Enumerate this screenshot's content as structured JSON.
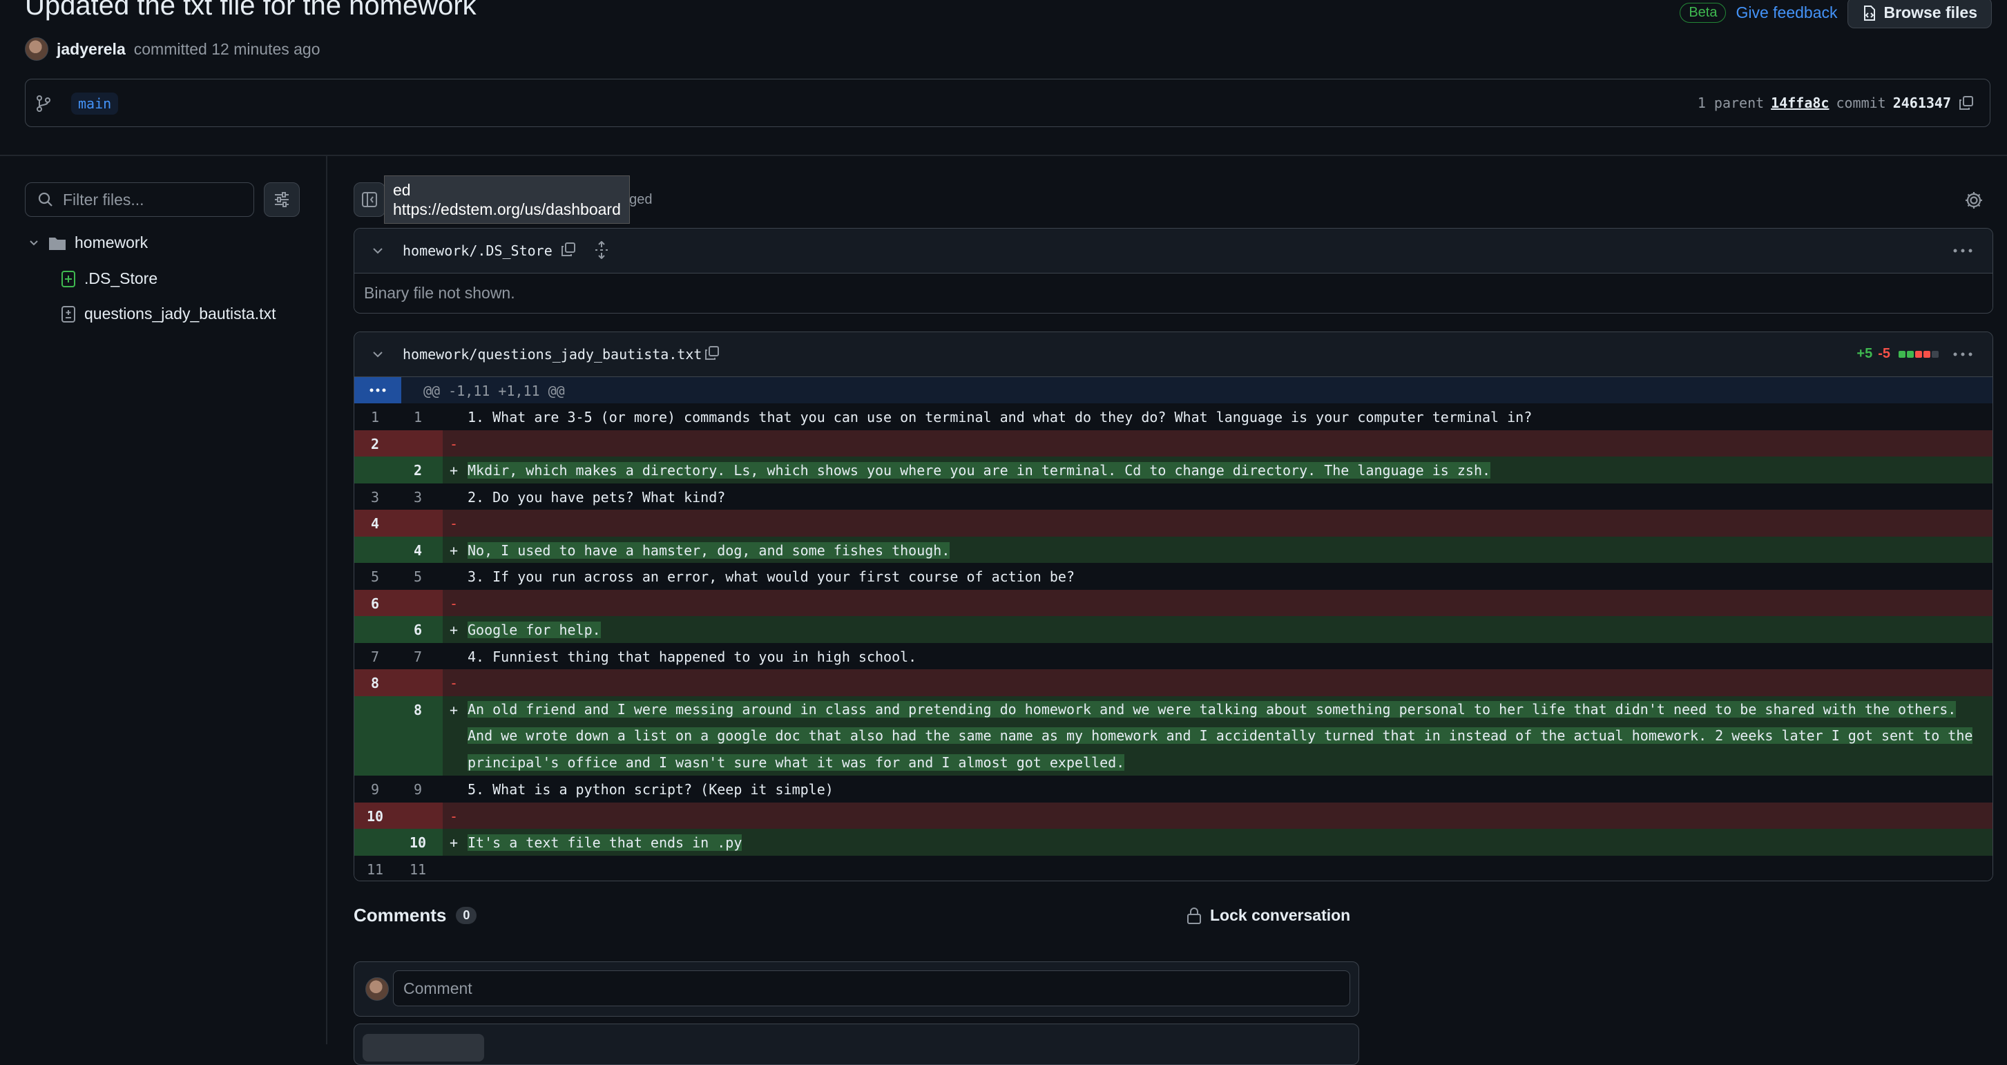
{
  "header": {
    "title": "Updated the txt file for the homework",
    "author": "jadyerela",
    "committed_text": "committed 12 minutes ago",
    "beta_label": "Beta",
    "feedback_label": "Give feedback",
    "browse_label": "Browse files"
  },
  "branch": {
    "name": "main",
    "parent_label": "1 parent",
    "parent_sha": "14ffa8c",
    "commit_label": "commit",
    "commit_sha": "2461347"
  },
  "sidebar": {
    "filter_placeholder": "Filter files...",
    "folder": "homework",
    "files": [
      ".DS_Store",
      "questions_jady_bautista.txt"
    ]
  },
  "tooltip": {
    "title": "ed",
    "url": "https://edstem.org/us/dashboard"
  },
  "changed_partial": "nged",
  "files": [
    {
      "name": "homework/.DS_Store",
      "binary_text": "Binary file not shown."
    },
    {
      "name": "homework/questions_jady_bautista.txt",
      "additions": "+5",
      "deletions": "-5"
    }
  ],
  "diff": {
    "hunk_header": "@@ -1,11 +1,11 @@",
    "rows": [
      {
        "type": "ctx",
        "old": "1",
        "new": "1",
        "sign": "",
        "code": "1. What are 3-5 (or more) commands that you can use on terminal and what do they do? What language is your computer terminal in?"
      },
      {
        "type": "del",
        "old": "2",
        "new": "",
        "sign": "-",
        "code": ""
      },
      {
        "type": "ins",
        "old": "",
        "new": "2",
        "sign": "+",
        "code": "Mkdir, which makes a directory. Ls, which shows you where you are in terminal. Cd to change directory. The language is zsh."
      },
      {
        "type": "ctx",
        "old": "3",
        "new": "3",
        "sign": "",
        "code": "2. Do you have pets? What kind?"
      },
      {
        "type": "del",
        "old": "4",
        "new": "",
        "sign": "-",
        "code": ""
      },
      {
        "type": "ins",
        "old": "",
        "new": "4",
        "sign": "+",
        "code": "No, I used to have a hamster, dog, and some fishes though."
      },
      {
        "type": "ctx",
        "old": "5",
        "new": "5",
        "sign": "",
        "code": "3. If you run across an error, what would your first course of action be?"
      },
      {
        "type": "del",
        "old": "6",
        "new": "",
        "sign": "-",
        "code": ""
      },
      {
        "type": "ins",
        "old": "",
        "new": "6",
        "sign": "+",
        "code": "Google for help."
      },
      {
        "type": "ctx",
        "old": "7",
        "new": "7",
        "sign": "",
        "code": "4. Funniest thing that happened to you in high school."
      },
      {
        "type": "del",
        "old": "8",
        "new": "",
        "sign": "-",
        "code": ""
      },
      {
        "type": "ins",
        "old": "",
        "new": "8",
        "sign": "+",
        "code": "An old friend and I were messing around in class and pretending do homework and we were talking about something personal to her life that didn't need to be shared with the others. And we wrote down a list on a google doc that also had the same name as my homework and I accidentally turned that in instead of the actual homework. 2 weeks later I got sent to the principal's office and I wasn't sure what it was for and I almost got expelled."
      },
      {
        "type": "ctx",
        "old": "9",
        "new": "9",
        "sign": "",
        "code": "5. What is a python script? (Keep it simple)"
      },
      {
        "type": "del",
        "old": "10",
        "new": "",
        "sign": "-",
        "code": ""
      },
      {
        "type": "ins",
        "old": "",
        "new": "10",
        "sign": "+",
        "code": "It's a text file that ends in .py"
      },
      {
        "type": "ctx",
        "old": "11",
        "new": "11",
        "sign": "",
        "code": ""
      }
    ]
  },
  "comments": {
    "title": "Comments",
    "count": "0",
    "lock_label": "Lock conversation",
    "placeholder": "Comment"
  },
  "colors": {
    "add": "#3fb950",
    "del": "#f85149",
    "link": "#4493f8"
  }
}
